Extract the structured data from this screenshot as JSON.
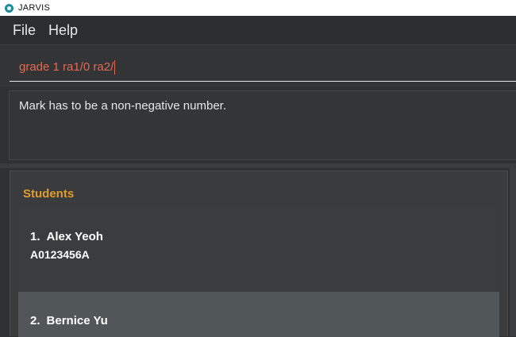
{
  "window": {
    "title": "JARVIS",
    "icon": "app-logo-icon"
  },
  "menu": {
    "items": [
      "File",
      "Help"
    ]
  },
  "command": {
    "value": "grade 1 ra1/0 ra2/",
    "text_color": "#e06a55"
  },
  "result": {
    "message": "Mark has to be a non-negative number."
  },
  "students": {
    "title": "Students",
    "accent": "#e09c2a",
    "items": [
      {
        "index": "1.",
        "name": "Alex Yeoh",
        "id": "A0123456A"
      },
      {
        "index": "2.",
        "name": "Bernice Yu",
        "id": ""
      }
    ]
  }
}
